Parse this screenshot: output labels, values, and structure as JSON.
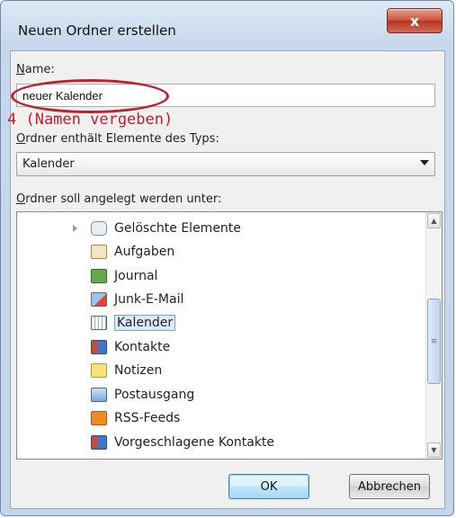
{
  "window": {
    "title": "Neuen Ordner erstellen",
    "close_label": "x"
  },
  "form": {
    "name_label_accel": "N",
    "name_label_rest": "ame:",
    "name_value": "neuer Kalender",
    "annotation": "4 (Namen vergeben)",
    "type_label_accel": "O",
    "type_label_rest": "rdner enthält Elemente des Typs:",
    "type_selected": "Kalender",
    "location_label_accel": "O",
    "location_label_rest": "rdner soll angelegt werden unter:"
  },
  "tree": {
    "items": [
      {
        "label": "Gelöschte Elemente",
        "icon": "recycle-icon"
      },
      {
        "label": "Aufgaben",
        "icon": "tasks-icon"
      },
      {
        "label": "Journal",
        "icon": "journal-icon"
      },
      {
        "label": "Junk-E-Mail",
        "icon": "junk-mail-icon"
      },
      {
        "label": "Kalender",
        "icon": "calendar-icon"
      },
      {
        "label": "Kontakte",
        "icon": "contacts-icon"
      },
      {
        "label": "Notizen",
        "icon": "notes-icon"
      },
      {
        "label": "Postausgang",
        "icon": "outbox-icon"
      },
      {
        "label": "RSS-Feeds",
        "icon": "rss-icon"
      },
      {
        "label": "Vorgeschlagene Kontakte",
        "icon": "suggested-contacts-icon"
      }
    ]
  },
  "buttons": {
    "ok": "OK",
    "cancel": "Abbrechen"
  },
  "colors": {
    "annotation": "#c0202b",
    "selection": "#dcebfc"
  }
}
